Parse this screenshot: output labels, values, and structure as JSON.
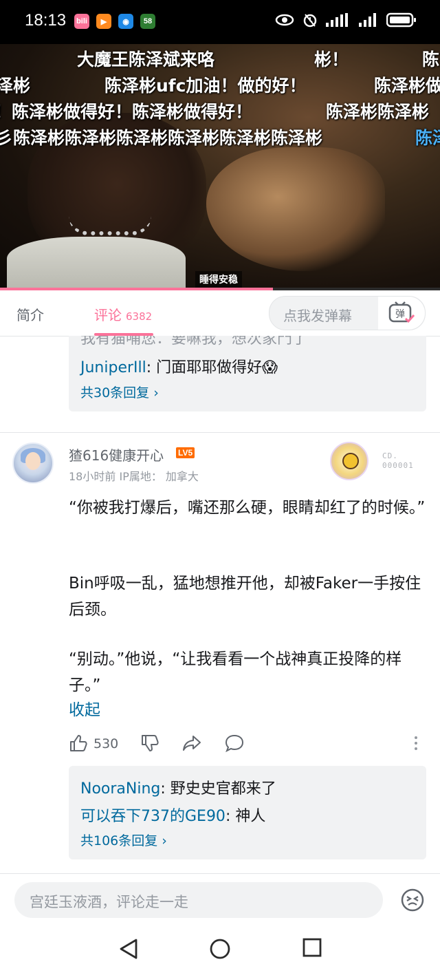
{
  "status_bar": {
    "time": "18:13",
    "apps": [
      {
        "name": "bilibili-app-icon",
        "label": "bili",
        "color": "#fb7299"
      },
      {
        "name": "video-app-icon",
        "label": "▶",
        "color": "#ff8a1f"
      },
      {
        "name": "weibo-app-icon",
        "label": "◉",
        "color": "#1e88e5"
      },
      {
        "name": "58-app-icon",
        "label": "58",
        "color": "#2e7d32"
      }
    ]
  },
  "video": {
    "danmaku": [
      "大魔王陈泽斌来咯",
      "彬！",
      "陈",
      "泽彬",
      "陈泽彬ufc加油！做的好！",
      "陈泽彬做",
      "！陈泽彬做得好！陈泽彬做得好！",
      "陈泽彬陈泽彬",
      "彡陈泽彬陈泽彬陈泽彬陈泽彬陈泽彬陈泽彬",
      "陈泽"
    ],
    "caption": "睡得安稳",
    "progress_fraction": 0.62
  },
  "tabs": {
    "intro": "简介",
    "comments": "评论",
    "comment_count": "6382",
    "danmaku_placeholder": "点我发弹幕",
    "danmaku_icon_label": "弹"
  },
  "prev_comment": {
    "partial_line": "我有猫哺您：要嘛我，想次家門了",
    "replies": [
      {
        "user": "JuniperIll",
        "text": ": 门面耶耶做得好😱"
      }
    ],
    "more_replies": "共30条回复 ›"
  },
  "comment": {
    "username": "猹616健康开心",
    "level": "LV5",
    "time": "18小时前",
    "ip_location": "IP属地： 加拿大",
    "fan_badge_text": [
      "CD.",
      "000001"
    ],
    "paragraphs": [
      "“你被我打爆后，嘴还那么硬，眼睛却红了的时候。”",
      "Bin呼吸一乱，猛地想推开他，却被Faker一手按住后颈。",
      "“别动。”他说，“让我看看一个战神真正投降的样子。”"
    ],
    "collapse": "收起",
    "like_count": "530",
    "replies": [
      {
        "user": "NooraNing",
        "text": ": 野史史官都来了"
      },
      {
        "user": "可以吞下737的GE90",
        "text": ": 神人"
      }
    ],
    "more_replies": "共106条回复 ›"
  },
  "bottom": {
    "input_placeholder": "宫廷玉液酒，评论走一走"
  }
}
